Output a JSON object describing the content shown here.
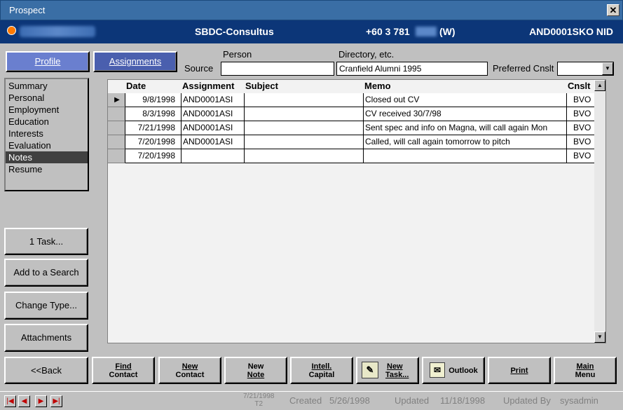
{
  "window": {
    "title": "Prospect",
    "close_glyph": "✕"
  },
  "header": {
    "organization": "SBDC-Consultus",
    "phone_prefix": "+60 3 781",
    "phone_type": "(W)",
    "record_code": "AND0001SKO  NID"
  },
  "tabs": {
    "profile": "Profile",
    "assignments": "Assignments"
  },
  "source": {
    "label": "Source",
    "person_label": "Person",
    "person_value": "",
    "directory_label": "Directory, etc.",
    "directory_value": "Cranfield Alumni 1995",
    "preferred_label": "Preferred Cnslt",
    "preferred_value": ""
  },
  "sidebar": {
    "items": [
      "Summary",
      "Personal",
      "Employment",
      "Education",
      "Interests",
      "Evaluation",
      "Notes",
      "Resume"
    ],
    "selected": "Notes"
  },
  "side_buttons": {
    "task": "1 Task...",
    "add_search": "Add to a Search",
    "change_type": "Change Type...",
    "attachments": "Attachments"
  },
  "grid": {
    "columns": [
      "Date",
      "Assignment",
      "Subject",
      "Memo",
      "Cnslt"
    ],
    "rows": [
      [
        "9/8/1998",
        "AND0001ASI",
        "",
        "Closed out CV",
        "BVO"
      ],
      [
        "8/3/1998",
        "AND0001ASI",
        "",
        "CV received 30/7/98",
        "BVO"
      ],
      [
        "7/21/1998",
        "AND0001ASI",
        "",
        "Sent spec and info on Magna, will call again Mon",
        "BVO"
      ],
      [
        "7/20/1998",
        "AND0001ASI",
        "",
        "Called, will call again tomorrow to pitch",
        "BVO"
      ],
      [
        "7/20/1998",
        "",
        "",
        "",
        "BVO"
      ]
    ]
  },
  "bottom_buttons": {
    "back": "<<Back",
    "find_contact_1": "Find",
    "find_contact_2": "Contact",
    "new_contact_1": "New",
    "new_contact_2": "Contact",
    "new_note_1": "New",
    "new_note_2": "Note",
    "intell_1": "Intell.",
    "intell_2": "Capital",
    "new_task_1": "New",
    "new_task_2": "Task...",
    "outlook": "Outlook",
    "print": "Print",
    "main_menu_1": "Main",
    "main_menu_2": "Menu"
  },
  "status": {
    "stamp_date": "7/21/1998",
    "stamp_code": "T2",
    "created_label": "Created",
    "created_value": "5/26/1998",
    "updated_label": "Updated",
    "updated_value": "11/18/1998",
    "updated_by_label": "Updated By",
    "updated_by_value": "sysadmin"
  }
}
